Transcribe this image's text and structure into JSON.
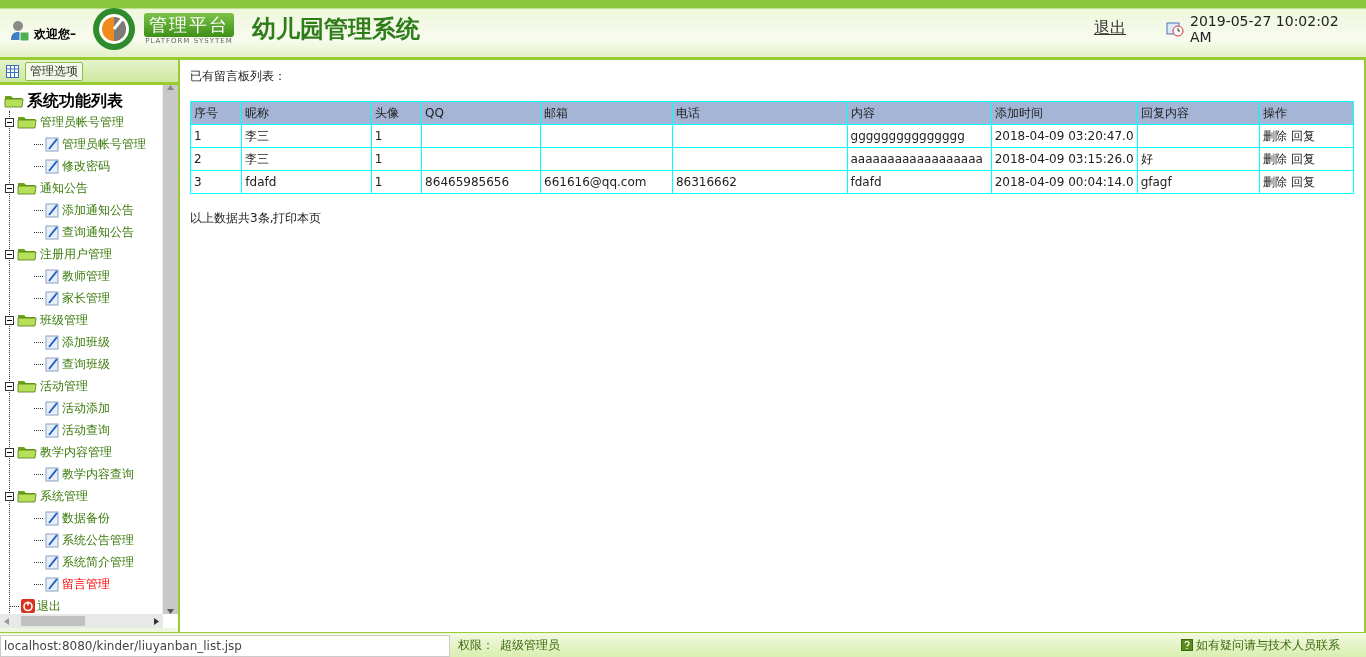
{
  "header": {
    "welcome": "欢迎您–",
    "logo_badge": "管理平台",
    "logo_subtitle": "PLATFORM SYSYTEM",
    "title": "幼儿园管理系统",
    "logout": "退出",
    "datetime": "2019-05-27 10:02:02 AM"
  },
  "sidebar": {
    "tab": "管理选项",
    "root": "系统功能列表",
    "groups": [
      {
        "label": "管理员帐号管理",
        "expanded": true,
        "children": [
          {
            "label": "管理员帐号管理",
            "selected": false
          },
          {
            "label": "修改密码",
            "selected": false
          }
        ]
      },
      {
        "label": "通知公告",
        "expanded": true,
        "children": [
          {
            "label": "添加通知公告",
            "selected": false
          },
          {
            "label": "查询通知公告",
            "selected": false
          }
        ]
      },
      {
        "label": "注册用户管理",
        "expanded": true,
        "children": [
          {
            "label": "教师管理",
            "selected": false
          },
          {
            "label": "家长管理",
            "selected": false
          }
        ]
      },
      {
        "label": "班级管理",
        "expanded": true,
        "children": [
          {
            "label": "添加班级",
            "selected": false
          },
          {
            "label": "查询班级",
            "selected": false
          }
        ]
      },
      {
        "label": "活动管理",
        "expanded": true,
        "children": [
          {
            "label": "活动添加",
            "selected": false
          },
          {
            "label": "活动查询",
            "selected": false
          }
        ]
      },
      {
        "label": "教学内容管理",
        "expanded": true,
        "children": [
          {
            "label": "教学内容查询",
            "selected": false
          }
        ]
      },
      {
        "label": "系统管理",
        "expanded": true,
        "children": [
          {
            "label": "数据备份",
            "selected": false
          },
          {
            "label": "系统公告管理",
            "selected": false
          },
          {
            "label": "系统简介管理",
            "selected": false
          },
          {
            "label": "留言管理",
            "selected": true
          }
        ]
      }
    ],
    "exit": "退出"
  },
  "content": {
    "heading": "已有留言板列表：",
    "table": {
      "columns": [
        "序号",
        "昵称",
        "头像",
        "QQ",
        "邮箱",
        "电话",
        "内容",
        "添加时间",
        "回复内容",
        "操作"
      ],
      "rows": [
        {
          "cells": [
            "1",
            "李三",
            "1",
            "",
            "",
            "",
            "ggggggggggggggg",
            "2018-04-09 03:20:47.0",
            ""
          ],
          "actions": [
            "删除",
            "回复"
          ]
        },
        {
          "cells": [
            "2",
            "李三",
            "1",
            "",
            "",
            "",
            "aaaaaaaaaaaaaaaaaa",
            "2018-04-09 03:15:26.0",
            "好"
          ],
          "actions": [
            "删除",
            "回复"
          ]
        },
        {
          "cells": [
            "3",
            "fdafd",
            "1",
            "86465985656",
            "661616@qq.com",
            "86316662",
            "fdafd",
            "2018-04-09 00:04:14.0",
            "gfagf"
          ],
          "actions": [
            "删除",
            "回复"
          ]
        }
      ]
    },
    "summary": {
      "text": "以上数据共3条,",
      "link": "打印本页"
    }
  },
  "status_bar": {
    "url": "localhost:8080/kinder/liuyanban_list.jsp",
    "role_label": "权限：",
    "role": "超级管理员",
    "help": "如有疑问请与技术人员联系"
  }
}
